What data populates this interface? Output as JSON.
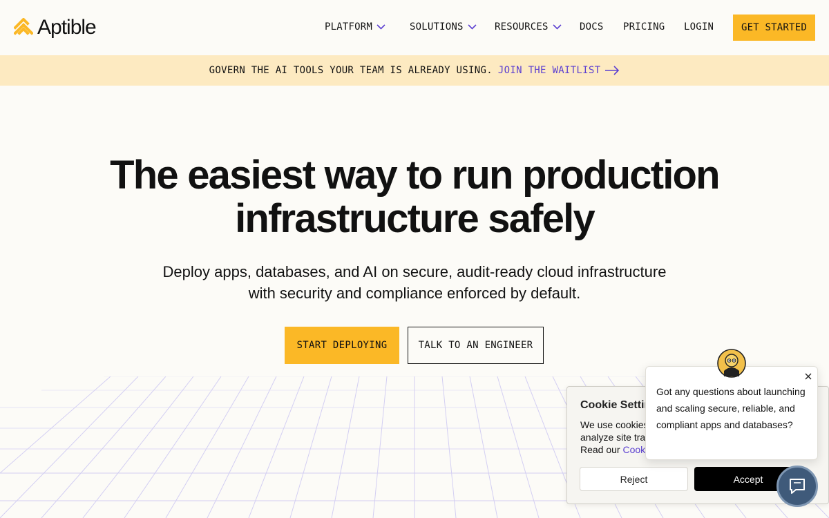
{
  "brand": {
    "name": "Aptible",
    "accent": "#fbb826",
    "link_color": "#5b3fd1"
  },
  "nav": {
    "platform": "PLATFORM",
    "solutions": "SOLUTIONS",
    "resources": "RESOURCES",
    "docs": "DOCS",
    "pricing": "PRICING",
    "login": "LOGIN",
    "cta": "GET STARTED"
  },
  "banner": {
    "text": "GOVERN THE AI TOOLS YOUR TEAM IS ALREADY USING.",
    "link": "JOIN THE WAITLIST"
  },
  "hero": {
    "title_line1": "The easiest way to run production",
    "title_line2": "infrastructure safely",
    "subtitle_line1": "Deploy apps, databases, and AI on secure, audit-ready cloud infrastructure",
    "subtitle_line2": "with security and compliance enforced by default.",
    "primary_cta": "START DEPLOYING",
    "secondary_cta": "TALK TO AN ENGINEER"
  },
  "cookie": {
    "title": "Cookie Settin",
    "line1": "We use cookies",
    "line2": "analyze site traf",
    "line3_prefix": "Read our ",
    "line3_link": "Cooki",
    "reject": "Reject",
    "accept": "Accept"
  },
  "chat": {
    "message": "Got any questions about launching and scaling secure, reliable, and compliant apps and databases?"
  }
}
